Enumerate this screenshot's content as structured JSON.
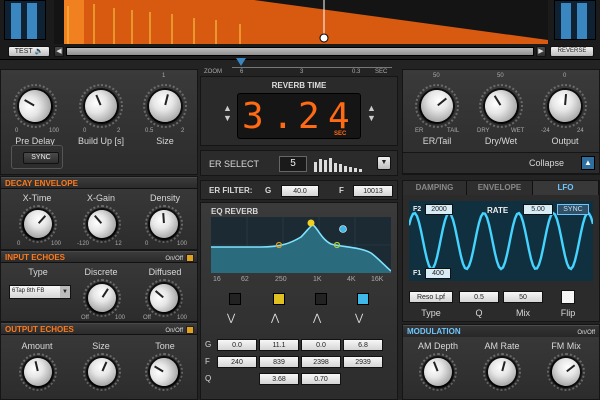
{
  "top": {
    "test_label": "TEST",
    "reverse_label": "REVERSE",
    "zoom_label": "ZOOM",
    "zoom_ticks": [
      "6",
      "3",
      "0.3",
      "SEC"
    ]
  },
  "reverb_time": {
    "title": "REVERB TIME",
    "digits": [
      "3",
      ".",
      "2",
      "4"
    ],
    "unit": "SEC"
  },
  "left_top": {
    "knobs": [
      {
        "label": "Pre Delay",
        "min": "0",
        "max": "100"
      },
      {
        "label": "Build Up [s]",
        "min": "0",
        "max": "2"
      },
      {
        "label": "Size",
        "min": "0.5",
        "max": "2",
        "top": "1"
      }
    ],
    "sync_label": "SYNC"
  },
  "right_top": {
    "knobs": [
      {
        "label": "ER/Tail",
        "min": "ER",
        "max": "TAIL",
        "top": "50"
      },
      {
        "label": "Dry/Wet",
        "min": "DRY",
        "max": "WET",
        "top": "50"
      },
      {
        "label": "Output",
        "min": "-24",
        "max": "24",
        "top": "0"
      }
    ],
    "collapse_label": "Collapse"
  },
  "er_select": {
    "label": "ER SELECT",
    "value": "5"
  },
  "decay": {
    "title": "DECAY ENVELOPE",
    "knobs": [
      {
        "label": "X-Time",
        "min": "0",
        "max": "100"
      },
      {
        "label": "X-Gain",
        "min": "-120",
        "max": "12"
      },
      {
        "label": "Density",
        "min": "0",
        "max": "100"
      }
    ]
  },
  "input_echoes": {
    "title": "INPUT ECHOES",
    "onoff": "On/Off",
    "type_label": "Type",
    "type_value": "6Tap 8th FB",
    "knobs": [
      {
        "label": "Discrete",
        "min": "Off",
        "max": "100"
      },
      {
        "label": "Diffused",
        "min": "Off",
        "max": "100"
      }
    ]
  },
  "output_echoes": {
    "title": "OUTPUT ECHOES",
    "onoff": "On/Off",
    "knobs": [
      {
        "label": "Amount"
      },
      {
        "label": "Size"
      },
      {
        "label": "Tone"
      }
    ]
  },
  "er_filter": {
    "label": "ER FILTER:",
    "g_label": "G",
    "g_value": "40.0",
    "f_label": "F",
    "f_value": "10013"
  },
  "eq": {
    "title": "EQ REVERB",
    "freqs": [
      "16",
      "62",
      "250",
      "1K",
      "4K",
      "16K"
    ],
    "colors": [
      "#222222",
      "#e0c020",
      "#222222",
      "#3fb8e8"
    ],
    "g_label": "G",
    "f_label": "F",
    "q_label": "Q",
    "g_values": [
      "0.0",
      "11.1",
      "0.0",
      "6.8"
    ],
    "f_values": [
      "240",
      "839",
      "2398",
      "2939"
    ],
    "q_values": [
      "3.68",
      "0.70"
    ]
  },
  "lfo": {
    "tabs": [
      "DAMPING",
      "ENVELOPE",
      "LFO"
    ],
    "f2_label": "F2",
    "f2_value": "2000",
    "f1_label": "F1",
    "f1_value": "400",
    "rate_label": "RATE",
    "rate_value": "5.00",
    "sync_label": "SYNC",
    "type_value": "Reso Lpf",
    "q_value": "0.5",
    "mix_value": "50",
    "type_label": "Type",
    "q_label": "Q",
    "mix_label": "Mix",
    "flip_label": "Flip"
  },
  "modulation": {
    "title": "MODULATION",
    "onoff": "On/Off",
    "knobs": [
      {
        "label": "AM Depth"
      },
      {
        "label": "AM Rate"
      },
      {
        "label": "FM Mix"
      }
    ]
  }
}
